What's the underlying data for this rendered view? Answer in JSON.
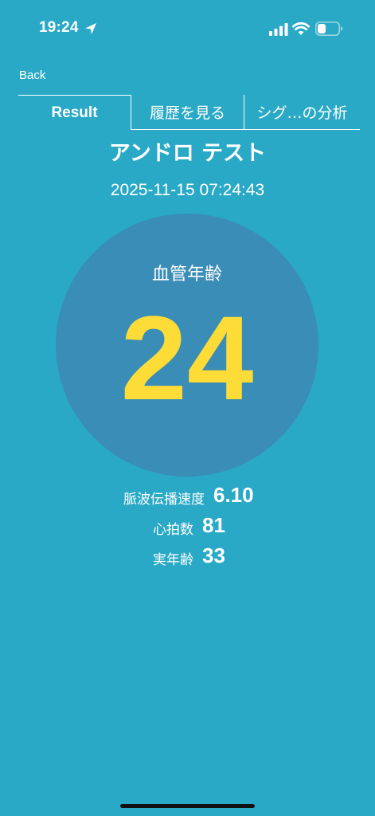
{
  "status_bar": {
    "time": "19:24"
  },
  "nav": {
    "back_label": "Back"
  },
  "tabs": [
    {
      "label": "Result",
      "selected": true
    },
    {
      "label": "履歴を見る",
      "selected": false
    },
    {
      "label": "シグ…の分析",
      "selected": false
    }
  ],
  "result": {
    "title": "アンドロ テスト",
    "timestamp": "2025-11-15 07:24:43",
    "vascular_age_label": "血管年齢",
    "vascular_age_value": "24",
    "stats": {
      "pwv_label": "脈波伝播速度",
      "pwv_value": "6.10",
      "heart_rate_label": "心拍数",
      "heart_rate_value": "81",
      "actual_age_label": "実年齢",
      "actual_age_value": "33"
    }
  },
  "colors": {
    "background": "#29a9c6",
    "circle": "#3a8db6",
    "highlight_value": "#fedc37",
    "text": "#ffffff"
  }
}
